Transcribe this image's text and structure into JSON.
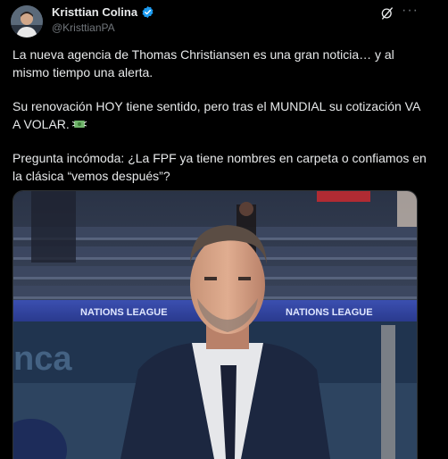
{
  "author": {
    "display_name": "Kristtian Colina",
    "handle": "@KristtianPA",
    "verified": true,
    "verified_color": "#1d9bf0"
  },
  "actions": {
    "grok_icon": "grok-icon",
    "more_icon": "more-icon",
    "more_label": "···"
  },
  "tweet": {
    "paragraphs": [
      "La nueva agencia de Thomas Christiansen es una gran noticia… y al mismo tiempo una alerta.",
      "Su renovación HOY tiene sentido, pero tras el MUNDIAL su cotización VA A VOLAR.",
      "Pregunta incómoda: ¿La FPF ya tiene nombres en carpeta o confiamos en la clásica “vemos después”?"
    ],
    "emoji_icon": "money-with-wings-icon"
  },
  "media": {
    "board_left_text": "NATIONS LEAGUE",
    "board_right_text": "NATIONS LEAGUE",
    "ad_text": "nca"
  },
  "colors": {
    "background": "#000000",
    "text": "#e7e9ea",
    "secondary": "#71767b",
    "accent": "#1d9bf0"
  }
}
